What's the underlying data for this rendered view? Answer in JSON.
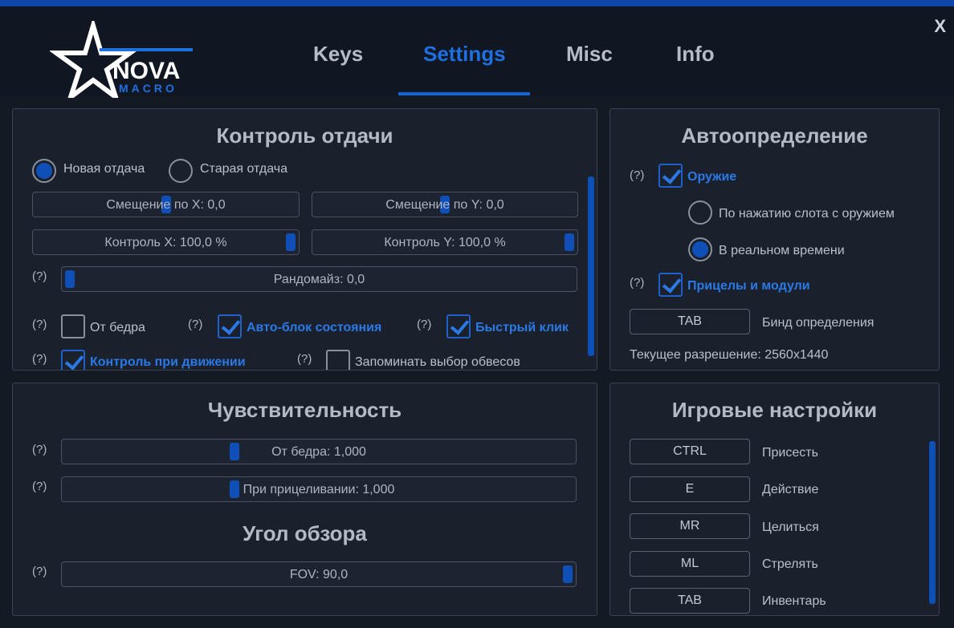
{
  "header": {
    "close": "X",
    "logo": {
      "name": "NOVA",
      "sub": "MACRO"
    },
    "tabs": [
      "Keys",
      "Settings",
      "Misc",
      "Info"
    ],
    "active_tab": "Settings"
  },
  "recoil": {
    "title": "Контроль отдачи",
    "mode_new": "Новая отдача",
    "mode_old": "Старая отдача",
    "selected_mode": "Новая отдача",
    "offset_x": {
      "label": "Смещение по X: 0,0",
      "value": 0.5
    },
    "offset_y": {
      "label": "Смещение по Y: 0,0",
      "value": 0.5
    },
    "control_x": {
      "label": "Контроль X: 100,0 %",
      "value": 1.0
    },
    "control_y": {
      "label": "Контроль Y: 100,0 %",
      "value": 1.0
    },
    "randomize": {
      "label": "Рандомайз: 0,0",
      "value": 0.0
    },
    "help": "(?)",
    "hipfire": {
      "label": "От бедра",
      "checked": false
    },
    "auto_block": {
      "label": "Авто-блок состояния",
      "checked": true
    },
    "fast_click": {
      "label": "Быстрый клик",
      "checked": true
    },
    "move_control": {
      "label": "Контроль при движении",
      "checked": true
    },
    "remember_attachments": {
      "label": "Запоминать выбор обвесов",
      "checked": false
    }
  },
  "autodetect": {
    "title": "Автоопределение",
    "weapon": {
      "label": "Оружие",
      "checked": true
    },
    "on_slot": "По нажатию слота с оружием",
    "realtime": "В реальном времени",
    "selected": "В реальном времени",
    "scopes": {
      "label": "Прицелы и модули",
      "checked": true
    },
    "bind_key": "TAB",
    "bind_label": "Бинд определения",
    "resolution": "Текущее разрешение: 2560x1440"
  },
  "sensitivity": {
    "title": "Чувствительность",
    "hip": {
      "label": "От бедра: 1,000",
      "value": 0.33
    },
    "ads": {
      "label": "При прицеливании: 1,000",
      "value": 0.33
    },
    "fov_title": "Угол обзора",
    "fov": {
      "label": "FOV: 90,0",
      "value": 1.0
    }
  },
  "game": {
    "title": "Игровые настройки",
    "binds": [
      {
        "key": "CTRL",
        "action": "Присесть"
      },
      {
        "key": "E",
        "action": "Действие"
      },
      {
        "key": "MR",
        "action": "Целиться"
      },
      {
        "key": "ML",
        "action": "Стрелять"
      },
      {
        "key": "TAB",
        "action": "Инвентарь"
      }
    ]
  },
  "colors": {
    "accent": "#1e6fe0",
    "background": "#141a24",
    "panel": "#1a212d",
    "thumb": "#0f4fb8"
  }
}
